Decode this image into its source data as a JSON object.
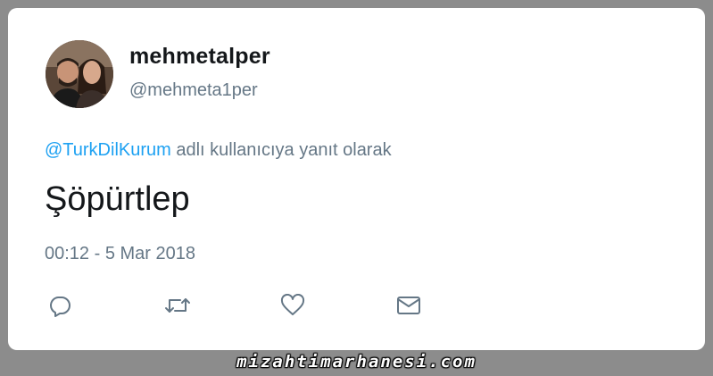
{
  "tweet": {
    "display_name": "mehmetalper",
    "handle": "@mehmeta1per",
    "reply_mention": "@TurkDilKurum",
    "reply_suffix": " adlı kullanıcıya yanıt olarak",
    "text": "Şöpürtlep",
    "timestamp": "00:12 - 5 Mar 2018"
  },
  "actions": {
    "reply_icon": "reply-icon",
    "retweet_icon": "retweet-icon",
    "like_icon": "heart-icon",
    "message_icon": "envelope-icon"
  },
  "watermark": {
    "text": "mizahtimarhanesi.com"
  },
  "colors": {
    "background": "#8c8c8c",
    "card": "#ffffff",
    "mention": "#1da1f2",
    "secondary_text": "#657786",
    "primary_text": "#14171a"
  }
}
